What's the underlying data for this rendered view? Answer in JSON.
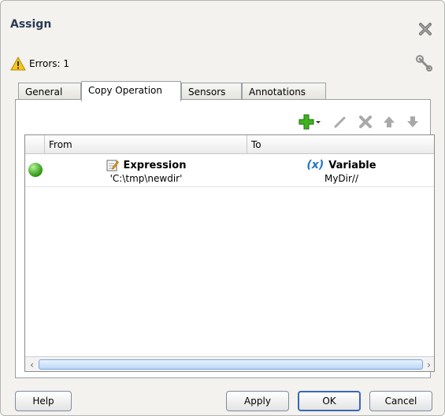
{
  "dialog": {
    "title": "Assign"
  },
  "status": {
    "errors_text": "Errors: 1"
  },
  "tabs": [
    {
      "label": "General"
    },
    {
      "label": "Copy Operation"
    },
    {
      "label": "Sensors"
    },
    {
      "label": "Annotations"
    }
  ],
  "table": {
    "columns": [
      "From",
      "To"
    ],
    "rows": [
      {
        "from_title": "Expression",
        "from_value": "'C:\\tmp\\newdir'",
        "to_icon": "(x)",
        "to_title": "Variable",
        "to_value": "MyDir//"
      }
    ]
  },
  "buttons": {
    "help": "Help",
    "apply": "Apply",
    "ok": "OK",
    "cancel": "Cancel"
  },
  "icons": {
    "close": "close-icon",
    "wrench": "wrench-icon",
    "warning": "warning-icon",
    "add": "add-icon",
    "edit": "edit-icon",
    "delete": "delete-icon",
    "move_up": "arrow-up-icon",
    "move_down": "arrow-down-icon"
  }
}
